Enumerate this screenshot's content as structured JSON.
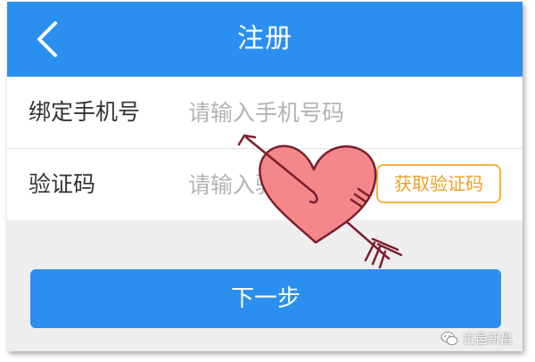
{
  "colors": {
    "primary": "#2b8ff0",
    "code_button": "#f3b33c",
    "heart_fill": "#f3878a",
    "heart_outline": "#7a1f2e"
  },
  "header": {
    "back_icon": "chevron-left-icon",
    "title": "注册"
  },
  "form": {
    "phone": {
      "label": "绑定手机号",
      "value": "",
      "placeholder": "请输入手机号码"
    },
    "code": {
      "label": "验证码",
      "value": "",
      "placeholder": "请输入验证码",
      "button_label": "获取验证码"
    }
  },
  "next_button_label": "下一步",
  "decoration": {
    "icon": "heart-with-arrow-icon"
  },
  "watermark": {
    "icon": "wechat-icon",
    "text": "古邑新昌"
  }
}
